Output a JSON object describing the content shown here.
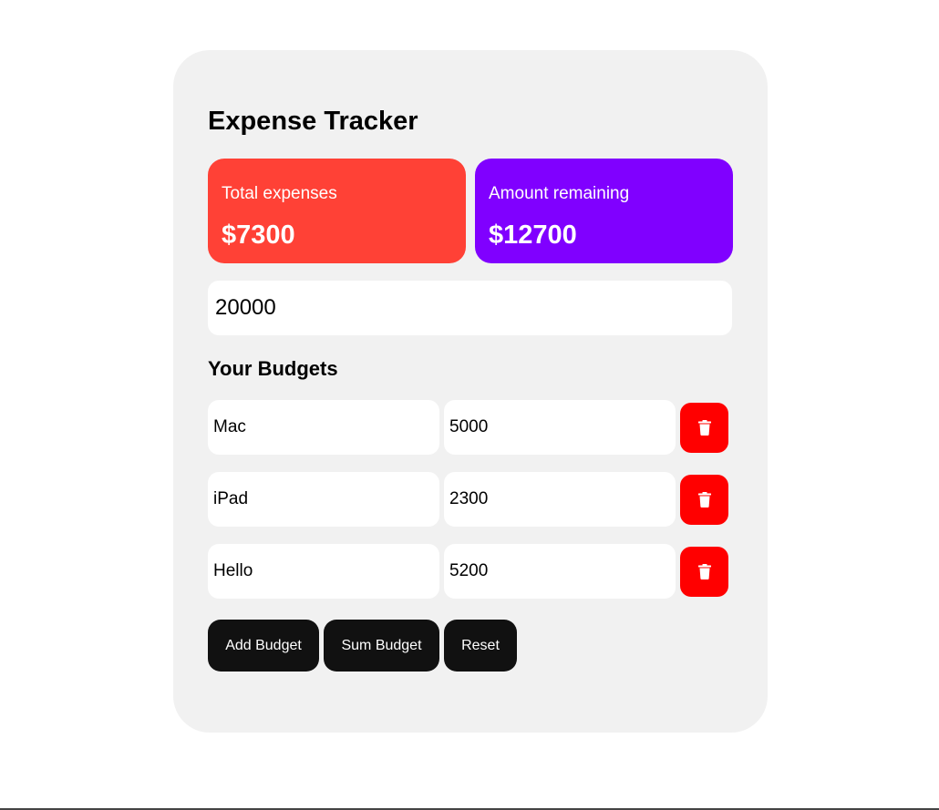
{
  "app": {
    "title": "Expense Tracker"
  },
  "stats": {
    "expenses": {
      "label": "Total expenses",
      "value": "$7300",
      "color": "#ff4136"
    },
    "remaining": {
      "label": "Amount remaining",
      "value": "$12700",
      "color": "#8000ff"
    }
  },
  "budget_total": {
    "value": "20000"
  },
  "budgets": {
    "title": "Your Budgets",
    "items": [
      {
        "name": "Mac",
        "amount": "5000"
      },
      {
        "name": "iPad",
        "amount": "2300"
      },
      {
        "name": "Hello",
        "amount": "5200"
      }
    ],
    "delete_icon": "trash-icon",
    "delete_color": "#ff0000"
  },
  "actions": {
    "add_label": "Add Budget",
    "sum_label": "Sum Budget",
    "reset_label": "Reset"
  }
}
